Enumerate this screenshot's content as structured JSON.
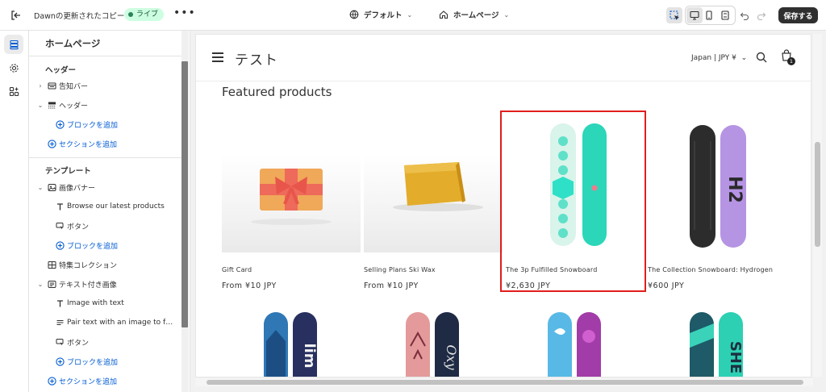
{
  "topbar": {
    "store_name": "Dawnの更新されたコピー",
    "live_label": "ライブ",
    "more_label": "•••",
    "theme_label": "デフォルト",
    "page_label": "ホームページ",
    "save_label": "保存する"
  },
  "sidebar": {
    "title": "ホームページ",
    "header_section": "ヘッダー",
    "header_items": [
      {
        "label": "告知バー"
      },
      {
        "label": "ヘッダー"
      },
      {
        "label": "ブロックを追加"
      },
      {
        "label": "セクションを追加"
      }
    ],
    "template_section": "テンプレート",
    "template_items": [
      {
        "label": "画像バナー"
      },
      {
        "label": "Browse our latest products"
      },
      {
        "label": "ボタン"
      },
      {
        "label": "ブロックを追加"
      },
      {
        "label": "特集コレクション"
      },
      {
        "label": "テキスト付き画像"
      },
      {
        "label": "Image with text"
      },
      {
        "label": "Pair text with an image to focu..."
      },
      {
        "label": "ボタン"
      },
      {
        "label": "ブロックを追加"
      },
      {
        "label": "セクションを追加"
      }
    ]
  },
  "preview": {
    "logo": "テスト",
    "locale": "Japan | JPY ¥",
    "cart_count": "1",
    "featured_title": "Featured products",
    "products": [
      {
        "name": "Gift Card",
        "price": "From ¥10 JPY"
      },
      {
        "name": "Selling Plans Ski Wax",
        "price": "From ¥10 JPY"
      },
      {
        "name": "The 3p Fulfilled Snowboard",
        "price": "¥2,630 JPY"
      },
      {
        "name": "The Collection Snowboard: Hydrogen",
        "price": "¥600 JPY"
      }
    ]
  },
  "colors": {
    "accent": "#005bd3",
    "live_bg": "#cdfee1",
    "live_dot": "#29845a",
    "highlight": "#e11d1d",
    "save_bg": "#303030"
  }
}
